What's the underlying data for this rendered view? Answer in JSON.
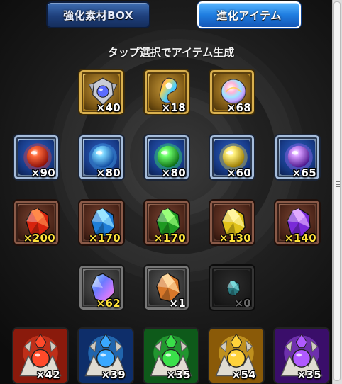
{
  "tabs": {
    "material_box": "強化素材BOX",
    "evolution_items": "進化アイテム"
  },
  "hint": "タップ選択でアイテム生成",
  "rows": [
    {
      "frame": "gold",
      "items": [
        {
          "icon": "silver-crest-icon",
          "count": "×40",
          "count_color": "white"
        },
        {
          "icon": "rainbow-spirit-icon",
          "count": "×18",
          "count_color": "white"
        },
        {
          "icon": "rainbow-orb-icon",
          "count": "×68",
          "count_color": "white"
        }
      ]
    },
    {
      "frame": "blue",
      "items": [
        {
          "icon": "red-orb-icon",
          "count": "×90",
          "count_color": "white"
        },
        {
          "icon": "blue-orb-icon",
          "count": "×80",
          "count_color": "white"
        },
        {
          "icon": "green-orb-icon",
          "count": "×80",
          "count_color": "white"
        },
        {
          "icon": "yellow-orb-icon",
          "count": "×60",
          "count_color": "white"
        },
        {
          "icon": "purple-orb-icon",
          "count": "×65",
          "count_color": "white"
        }
      ]
    },
    {
      "frame": "brown",
      "items": [
        {
          "icon": "red-crystal-icon",
          "count": "×200",
          "count_color": "yellow"
        },
        {
          "icon": "blue-crystal-icon",
          "count": "×170",
          "count_color": "yellow"
        },
        {
          "icon": "green-crystal-icon",
          "count": "×170",
          "count_color": "yellow"
        },
        {
          "icon": "yellow-crystal-icon",
          "count": "×130",
          "count_color": "yellow"
        },
        {
          "icon": "purple-crystal-icon",
          "count": "×140",
          "count_color": "yellow"
        }
      ]
    },
    {
      "frame": "gray",
      "items": [
        {
          "icon": "rainbow-crystal-icon",
          "count": "×62",
          "count_color": "yellow"
        },
        {
          "icon": "amber-crystal-icon",
          "count": "×1",
          "count_color": "white"
        },
        {
          "icon": "teal-crystal-icon",
          "count": "×0",
          "count_color": "dim"
        }
      ]
    },
    {
      "frame": "char",
      "items": [
        {
          "icon": "fire-statue-icon",
          "count": "×42",
          "count_color": "white"
        },
        {
          "icon": "water-statue-icon",
          "count": "×39",
          "count_color": "white"
        },
        {
          "icon": "wood-statue-icon",
          "count": "×35",
          "count_color": "white"
        },
        {
          "icon": "light-statue-icon",
          "count": "×54",
          "count_color": "white"
        },
        {
          "icon": "dark-statue-icon",
          "count": "×35",
          "count_color": "white"
        }
      ]
    }
  ],
  "colors": {
    "count_white": "#ffffff",
    "count_yellow": "#ffe23a",
    "count_dim": "#6a6a6a",
    "tab_active": "#1f7de0",
    "tab_inactive": "#1e3f7b"
  }
}
